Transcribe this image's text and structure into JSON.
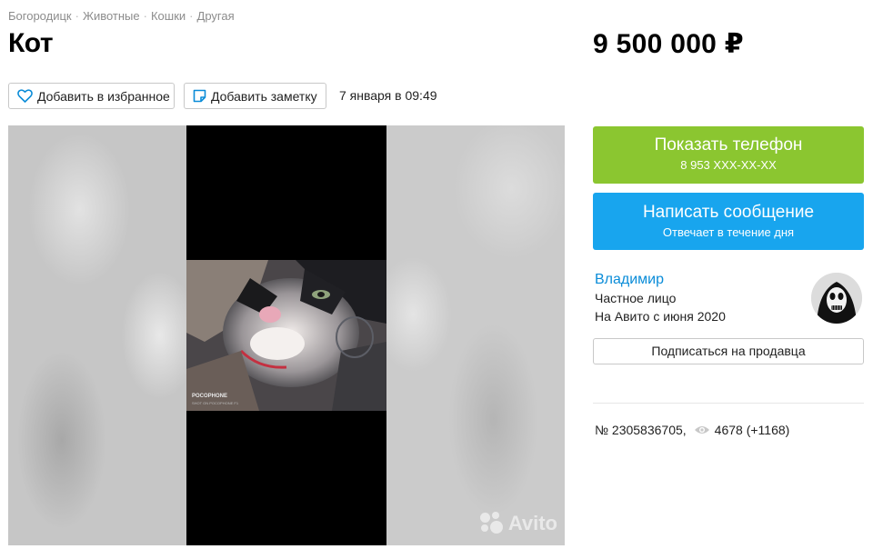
{
  "breadcrumbs": [
    "Богородицк",
    "Животные",
    "Кошки",
    "Другая"
  ],
  "breadcrumb_separator": "·",
  "listing": {
    "title": "Кот",
    "price": "9 500 000 ₽",
    "date": "7 января в 09:49",
    "number": "№ 2305836705,",
    "views": "4678 (+1168)"
  },
  "actions": {
    "favorite_label": "Добавить в избранное",
    "note_label": "Добавить заметку"
  },
  "gallery": {
    "photo_caption": "POCOPHONE",
    "photo_caption_sub": "SHOT ON POCOPHONE F1",
    "watermark": "Avito"
  },
  "contact": {
    "phone_label": "Показать телефон",
    "phone_masked": "8 953 XXX-XX-XX",
    "message_label": "Написать сообщение",
    "message_sub": "Отвечает в течение дня"
  },
  "seller": {
    "name": "Владимир",
    "type": "Частное лицо",
    "since": "На Авито с июня 2020",
    "subscribe_label": "Подписаться на продавца"
  },
  "colors": {
    "phone_button": "#8bc630",
    "message_button": "#18a5ee",
    "seller_link": "#0a8cd8"
  },
  "icons": {
    "favorite": "heart-outline-icon",
    "note": "note-icon",
    "views": "eye-icon",
    "watermark": "avito-logo-icon"
  }
}
